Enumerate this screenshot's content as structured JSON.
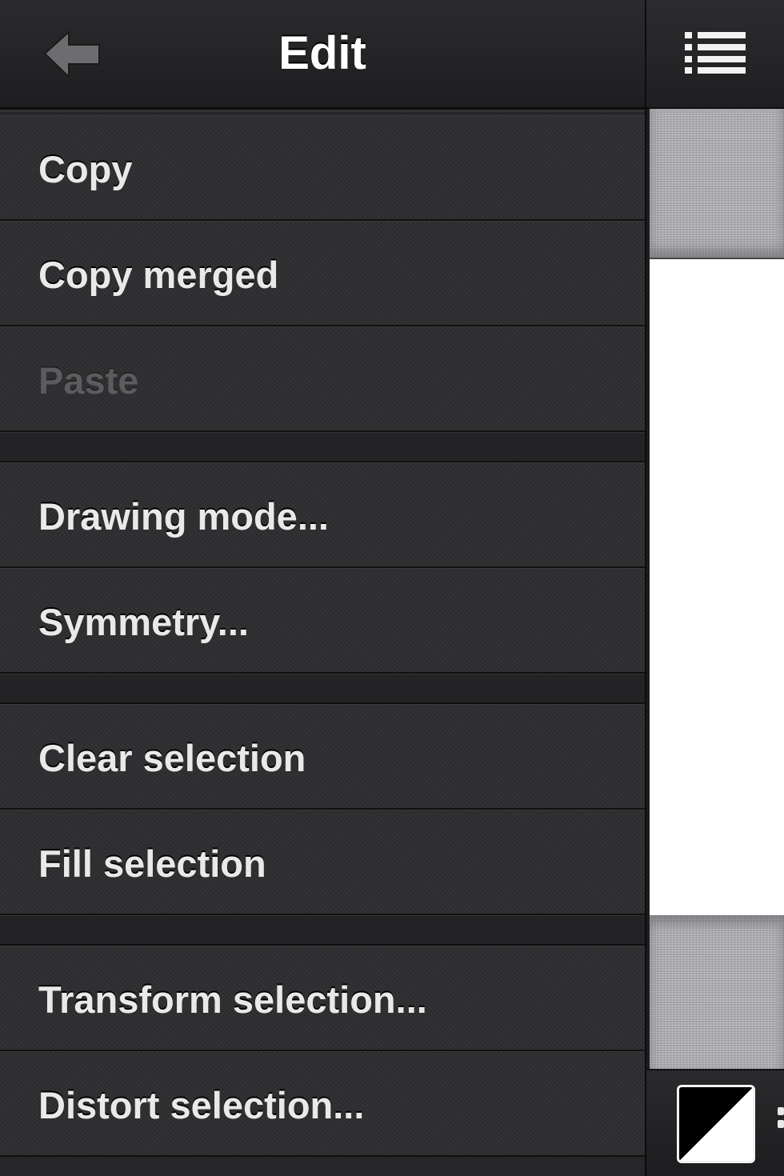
{
  "header": {
    "title": "Edit",
    "back_icon": "back-arrow-icon",
    "menu_icon": "list-icon"
  },
  "menu": {
    "group1": [
      {
        "label": "Copy",
        "enabled": true
      },
      {
        "label": "Copy merged",
        "enabled": true
      },
      {
        "label": "Paste",
        "enabled": false
      }
    ],
    "group2": [
      {
        "label": "Drawing mode...",
        "enabled": true
      },
      {
        "label": "Symmetry...",
        "enabled": true
      }
    ],
    "group3": [
      {
        "label": "Clear selection",
        "enabled": true
      },
      {
        "label": "Fill selection",
        "enabled": true
      }
    ],
    "group4": [
      {
        "label": "Transform selection...",
        "enabled": true
      },
      {
        "label": "Distort selection...",
        "enabled": true
      }
    ]
  },
  "colors": {
    "primary": "#000000",
    "secondary": "#ffffff",
    "text": "#e9e9e9",
    "disabled_text": "#5c5c5e"
  }
}
